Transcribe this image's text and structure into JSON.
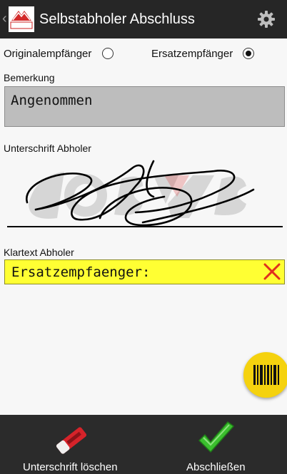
{
  "app": {
    "title": "Selbstabholer Abschluss",
    "logo_text": "COSYS",
    "back_icon": "chevron-left-icon",
    "settings_icon": "gear-icon"
  },
  "recipient": {
    "original_label": "Originalempfänger",
    "original_checked": false,
    "substitute_label": "Ersatzempfänger",
    "substitute_checked": true
  },
  "remark": {
    "label": "Bemerkung",
    "value": "Angenommen"
  },
  "signature": {
    "label": "Unterschrift Abholer",
    "watermark_text": "COSYS"
  },
  "cleartext": {
    "label": "Klartext Abholer",
    "value": "Ersatzempfaenger:",
    "clear_icon": "close-icon"
  },
  "fab": {
    "icon": "barcode-icon"
  },
  "bottom": {
    "clear_signature_label": "Unterschrift löschen",
    "clear_signature_icon": "eraser-icon",
    "finish_label": "Abschließen",
    "finish_icon": "checkmark-icon"
  },
  "colors": {
    "actionbar": "#262626",
    "remark_bg": "#bdbdbd",
    "cleartext_bg": "#ffff33",
    "fab": "#f5d20e",
    "check": "#3bbf2e",
    "clear_x": "#e0301e"
  }
}
